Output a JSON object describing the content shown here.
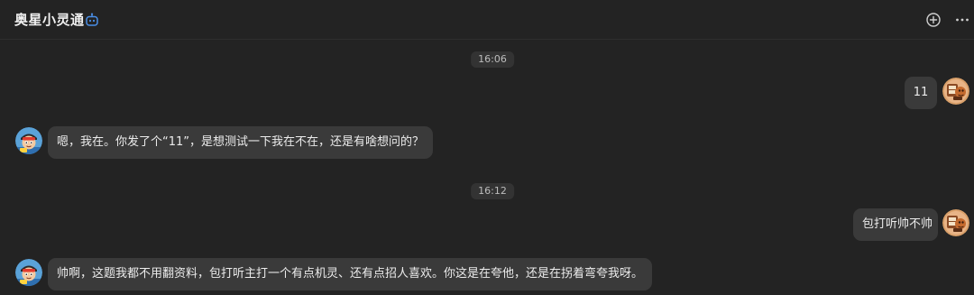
{
  "header": {
    "title": "奥星小灵通",
    "bot_icon": "bot-icon",
    "actions": [
      {
        "icon": "add-circle-icon"
      },
      {
        "icon": "more-icon"
      }
    ]
  },
  "conversation": {
    "timestamps": [
      "16:06",
      "16:12"
    ],
    "messages": [
      {
        "role": "user",
        "text": "11"
      },
      {
        "role": "assistant",
        "text": "嗯，我在。你发了个“11”，是想测试一下我在不在，还是有啥想问的？"
      },
      {
        "role": "user",
        "text": "包打听帅不帅"
      },
      {
        "role": "assistant",
        "text": "帅啊，这题我都不用翻资料，包打听主打一个有点机灵、还有点招人喜欢。你这是在夸他，还是在拐着弯夸我呀。"
      }
    ]
  },
  "colors": {
    "background": "#232323",
    "bubble": "#3a3a3a",
    "timestamp_bg": "#333333",
    "accent": "#4a8fe8"
  }
}
